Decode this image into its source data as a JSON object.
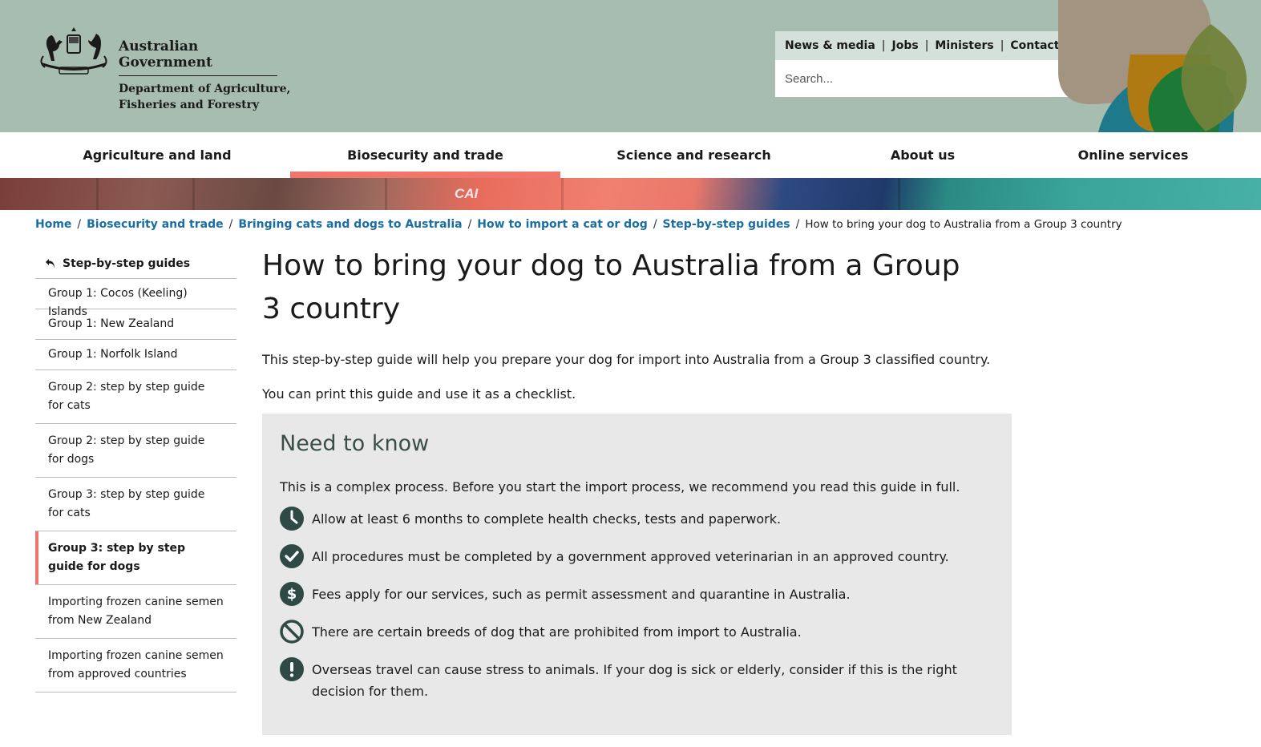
{
  "header": {
    "gov_name": "Australian Government",
    "dept_line1": "Department of Agriculture,",
    "dept_line2": "Fisheries and Forestry",
    "utility_links": [
      "News & media",
      "Jobs",
      "Ministers",
      "Contact us"
    ],
    "search_placeholder": "Search..."
  },
  "nav": {
    "items": [
      "Agriculture and land",
      "Biosecurity and trade",
      "Science and research",
      "About us",
      "Online services"
    ],
    "active": "Biosecurity and trade"
  },
  "banner": {
    "container_mark": "CAI"
  },
  "breadcrumb": {
    "links": [
      "Home",
      "Biosecurity and trade",
      "Bringing cats and dogs to Australia",
      "How to import a cat or dog",
      "Step-by-step guides"
    ],
    "current": "How to bring your dog to Australia from a Group 3 country"
  },
  "sidebar": {
    "back_label": "Step-by-step guides",
    "items": [
      "Group 1: Cocos (Keeling) Islands",
      "Group 1: New Zealand",
      "Group 1: Norfolk Island",
      "Group 2: step by step guide for cats",
      "Group 2: step by step guide for dogs",
      "Group 3: step by step guide for cats",
      "Group 3: step by step guide for dogs",
      "Importing frozen canine semen from New Zealand",
      "Importing frozen canine semen from approved countries"
    ],
    "active": "Group 3: step by step guide for dogs"
  },
  "main": {
    "title": "How to bring your dog to Australia from a Group 3 country",
    "intro": "This step-by-step guide will help you prepare your dog for import into Australia from a Group 3 classified country.",
    "print_note": "You can print this guide and use it as a checklist."
  },
  "need_to_know": {
    "title": "Need to know",
    "lead": "This is a complex process. Before you start the import process, we recommend you read this guide in full.",
    "items": [
      {
        "icon": "clock-icon",
        "text": "Allow at least 6 months to complete health checks, tests and paperwork."
      },
      {
        "icon": "check-icon",
        "text": "All procedures must be completed by a government approved veterinarian in an approved country."
      },
      {
        "icon": "dollar-icon",
        "text": "Fees apply for our services, such as permit assessment and quarantine in Australia."
      },
      {
        "icon": "prohibited-icon",
        "text": "There are certain breeds of dog that are prohibited from import to Australia."
      },
      {
        "icon": "exclamation-icon",
        "text": "Overseas travel can cause stress to animals. If your dog is sick or elderly, consider if this is the right decision for them."
      }
    ]
  },
  "colors": {
    "header_bg": "#a6bdb0",
    "utility_bg": "#d4e1da",
    "accent": "#f0766b",
    "link": "#1a6fa0",
    "icon_dark": "#2f4a44",
    "box_bg": "#e8e8e8"
  }
}
